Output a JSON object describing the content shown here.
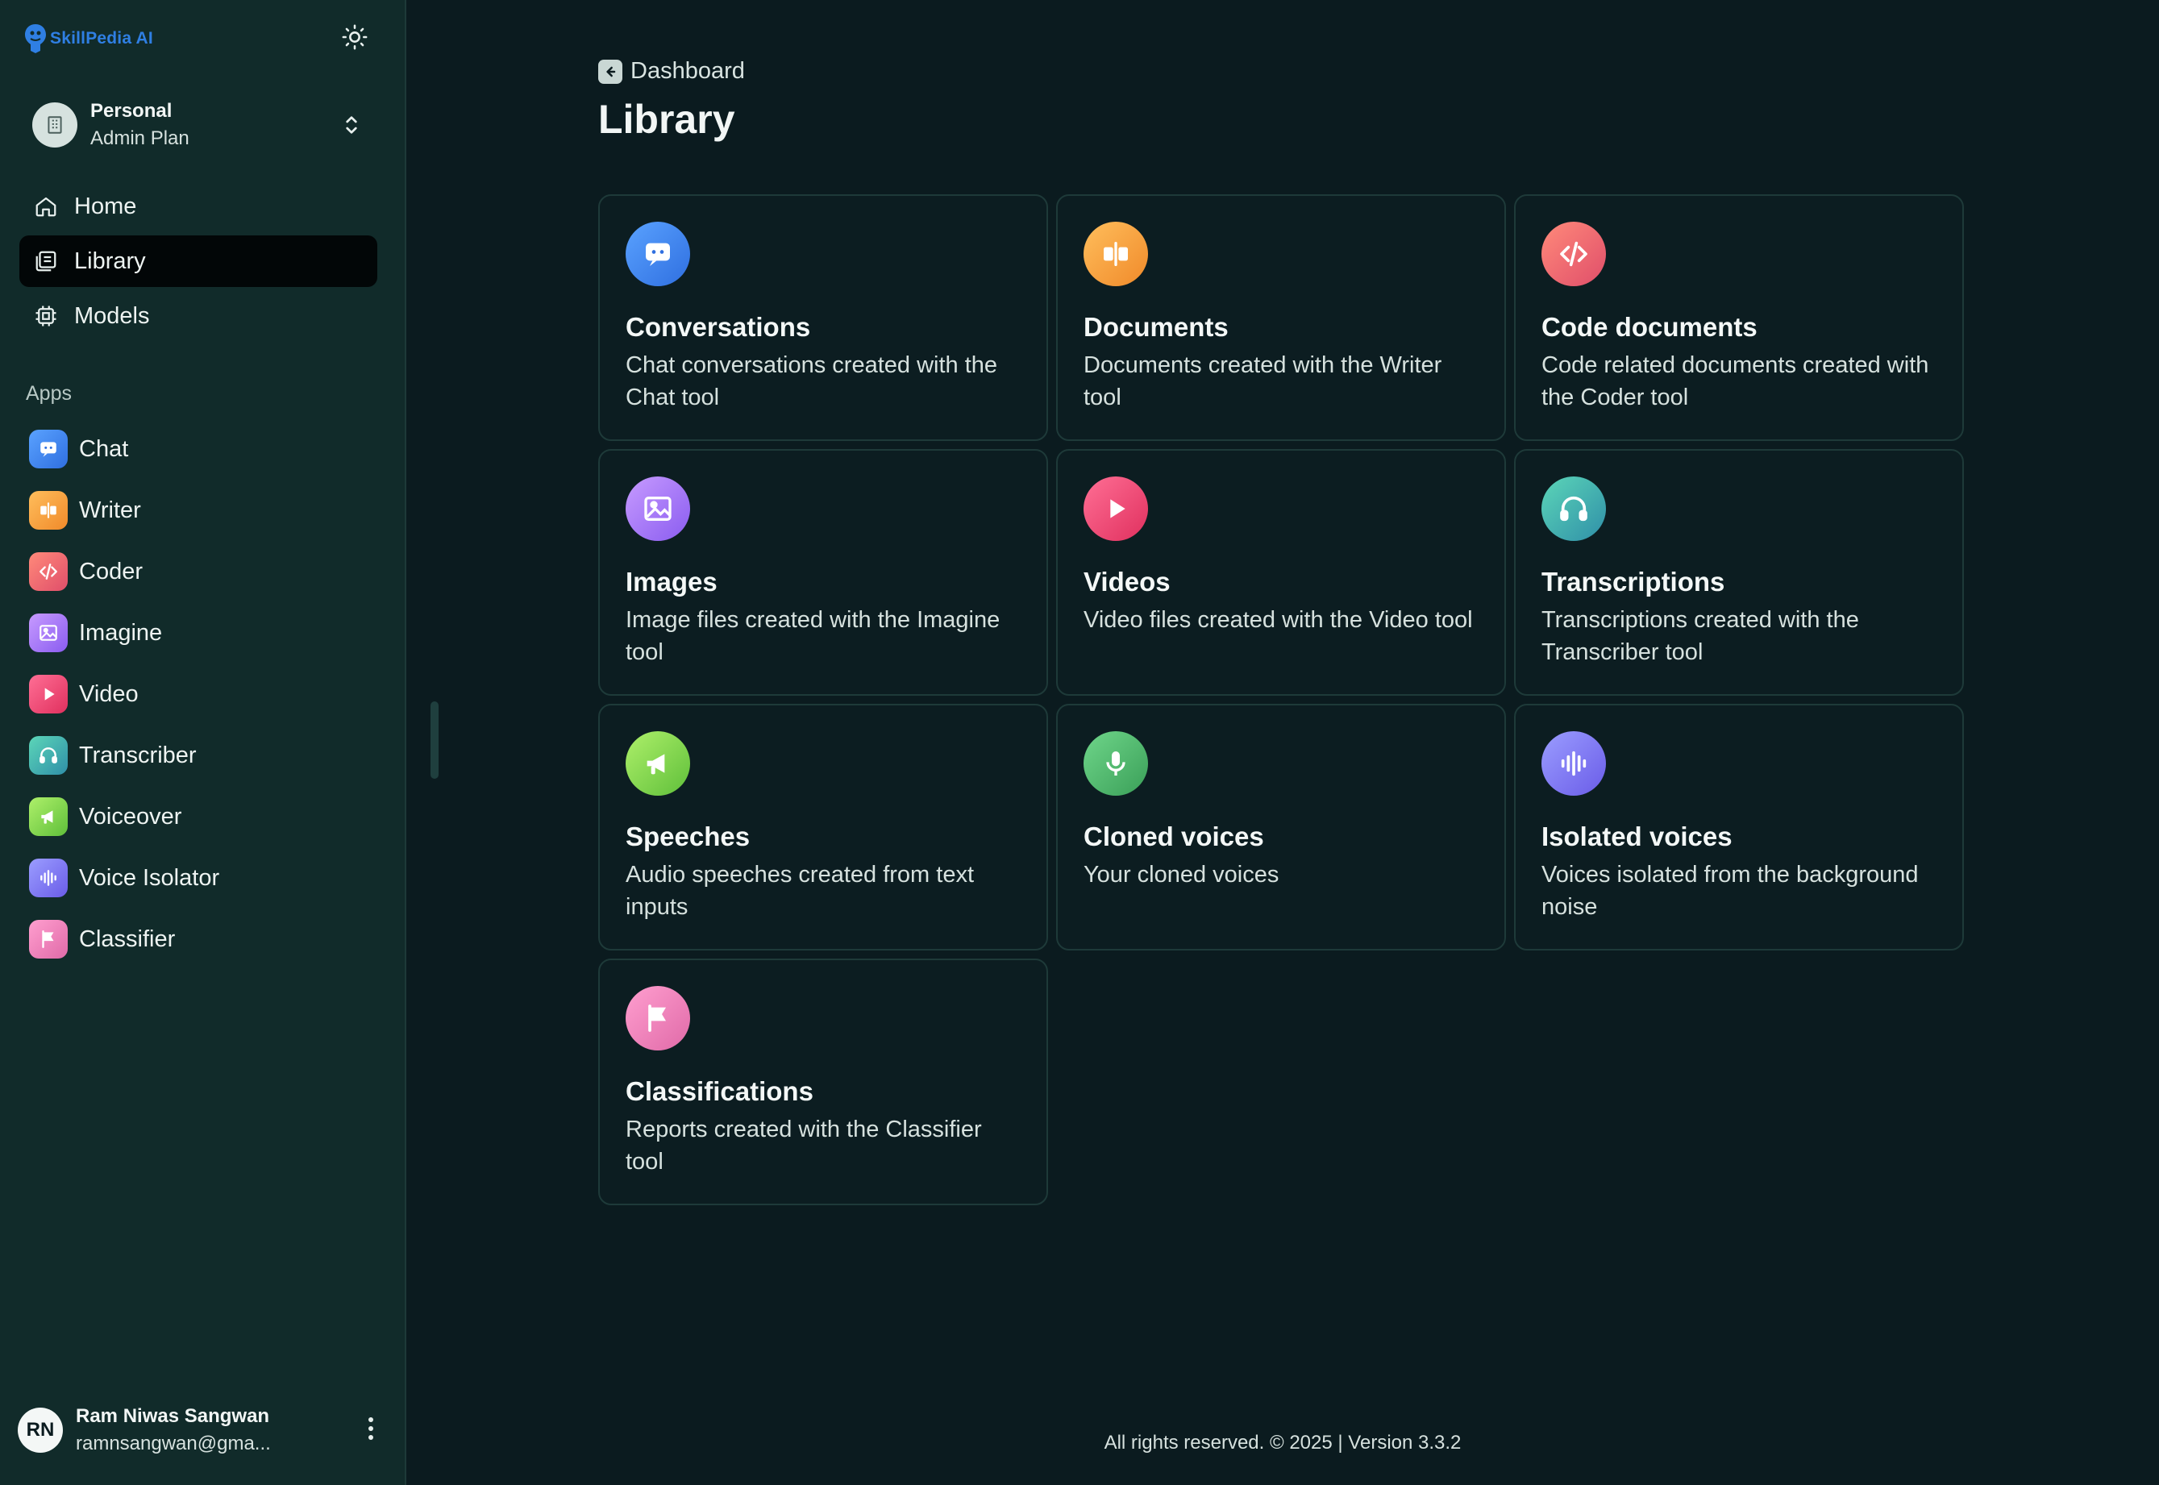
{
  "brand": {
    "name": "SkillPedia AI",
    "logo_icon": "skillpedia-logo-icon"
  },
  "theme_toggle": {
    "icon": "sun-icon"
  },
  "workspace": {
    "name": "Personal",
    "plan": "Admin Plan",
    "icon": "building-icon"
  },
  "nav": [
    {
      "label": "Home",
      "icon": "home-icon",
      "active": false
    },
    {
      "label": "Library",
      "icon": "library-icon",
      "active": true
    },
    {
      "label": "Models",
      "icon": "chip-icon",
      "active": false
    }
  ],
  "apps_label": "Apps",
  "apps": [
    {
      "label": "Chat",
      "icon": "chat-icon",
      "color": "#3a86f0"
    },
    {
      "label": "Writer",
      "icon": "writer-icon",
      "color": "#f2a43a"
    },
    {
      "label": "Coder",
      "icon": "code-icon",
      "color": "#ef6b6b"
    },
    {
      "label": "Imagine",
      "icon": "image-icon",
      "color": "#a57bf2"
    },
    {
      "label": "Video",
      "icon": "play-icon",
      "color": "#f0507a"
    },
    {
      "label": "Transcriber",
      "icon": "headphones-icon",
      "color": "#3fb7a4"
    },
    {
      "label": "Voiceover",
      "icon": "megaphone-icon",
      "color": "#8fd64a"
    },
    {
      "label": "Voice Isolator",
      "icon": "waveform-icon",
      "color": "#7b7ff2"
    },
    {
      "label": "Classifier",
      "icon": "flag-icon",
      "color": "#ee7fb8"
    }
  ],
  "user": {
    "initials": "RN",
    "name": "Ram Niwas Sangwan",
    "email": "ramnsangwan@gma..."
  },
  "breadcrumb": {
    "label": "Dashboard"
  },
  "page_title": "Library",
  "cards": [
    {
      "title": "Conversations",
      "desc": "Chat conversations created with the Chat tool",
      "icon": "chat-icon",
      "color": "#3a86f0"
    },
    {
      "title": "Documents",
      "desc": "Documents created with the Writer tool",
      "icon": "writer-icon",
      "color": "#f2a43a"
    },
    {
      "title": "Code documents",
      "desc": "Code related documents created with the Coder tool",
      "icon": "code-icon",
      "color": "#ef6b6b"
    },
    {
      "title": "Images",
      "desc": "Image files created with the Imagine tool",
      "icon": "image-icon",
      "color": "#a57bf2"
    },
    {
      "title": "Videos",
      "desc": "Video files created with the Video tool",
      "icon": "play-icon",
      "color": "#f0507a"
    },
    {
      "title": "Transcriptions",
      "desc": "Transcriptions created with the Transcriber tool",
      "icon": "headphones-icon",
      "color": "#3fb7a4"
    },
    {
      "title": "Speeches",
      "desc": "Audio speeches created from text inputs",
      "icon": "megaphone-icon",
      "color": "#8fd64a"
    },
    {
      "title": "Cloned voices",
      "desc": "Your cloned voices",
      "icon": "mic-icon",
      "color": "#4caf68"
    },
    {
      "title": "Isolated voices",
      "desc": "Voices isolated from the background noise",
      "icon": "waveform-icon",
      "color": "#7b7ff2"
    },
    {
      "title": "Classifications",
      "desc": "Reports created with the Classifier tool",
      "icon": "flag-icon",
      "color": "#ee7fb8"
    }
  ],
  "footer": {
    "text": "All rights reserved. © 2025 | Version 3.3.2"
  }
}
